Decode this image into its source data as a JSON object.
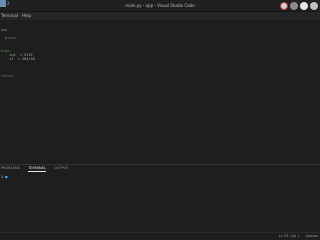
{
  "workspace": {
    "number": "2"
  },
  "window": {
    "title": "main.py - app - Visual Studio Code"
  },
  "menu": {
    "items": [
      "Terminal",
      "Help"
    ]
  },
  "editor": {
    "lines": [
      {
        "text": "app",
        "tone": "dim"
      },
      {
        "text": ""
      },
      {
        "text": "  print",
        "tone": "dim"
      },
      {
        "text": ""
      },
      {
        "text": ""
      },
      {
        "text": ""
      },
      {
        "text": "else:",
        "tone": "dim"
      },
      {
        "text": "    int  = 5132",
        "tone": "green"
      },
      {
        "text": "    if  = 484/40",
        "tone": "green"
      },
      {
        "text": ""
      },
      {
        "text": ""
      },
      {
        "text": ""
      },
      {
        "text": ""
      },
      {
        "text": "return",
        "tone": "dim"
      }
    ]
  },
  "panel": {
    "tabs": [
      "PROBLEMS",
      "TERMINAL",
      "OUTPUT"
    ],
    "active_tab": 1,
    "prompt": "$ ■"
  },
  "status": {
    "position": "Ln 15, Col 1",
    "encoding": "Spaces"
  }
}
